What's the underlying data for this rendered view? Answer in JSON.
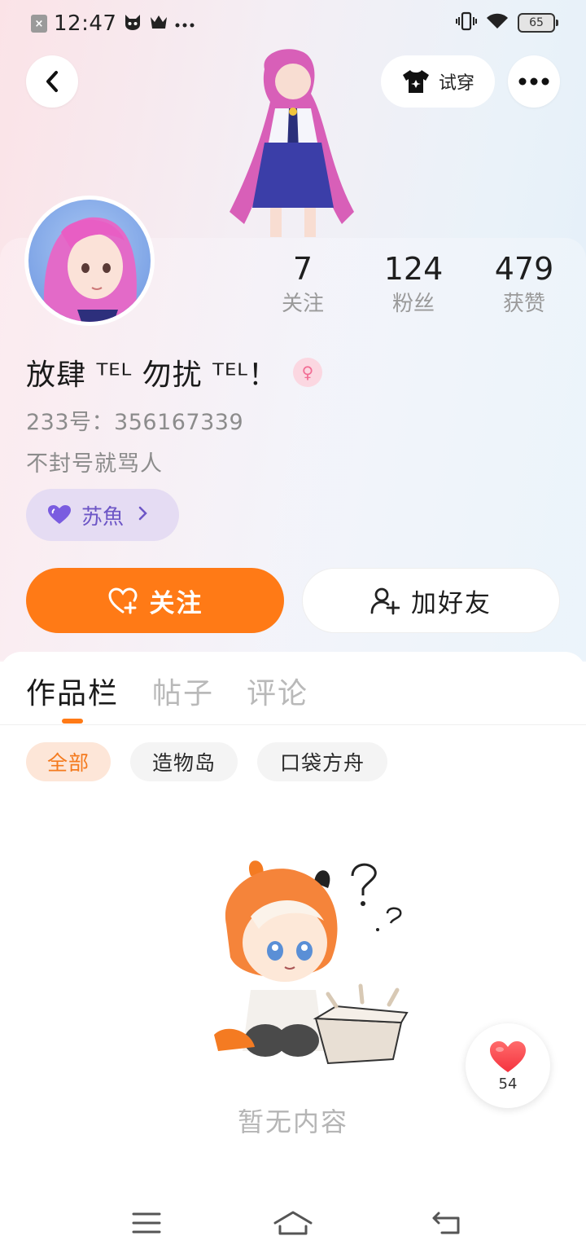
{
  "status_bar": {
    "time": "12:47",
    "battery": "65",
    "left_icons": [
      "sim-off-icon",
      "cat-face-icon",
      "crown-icon",
      "more-dots-icon"
    ],
    "right_icons": [
      "vibrate-icon",
      "wifi-icon",
      "battery-icon"
    ]
  },
  "header": {
    "try_on_label": "试穿"
  },
  "stats": [
    {
      "value": "7",
      "label": "关注"
    },
    {
      "value": "124",
      "label": "粉丝"
    },
    {
      "value": "479",
      "label": "获赞"
    }
  ],
  "profile": {
    "name": "放肆 ᵀᴱᴸ 勿扰 ᵀᴱᴸ！",
    "gender_symbol": "♀",
    "uid_line": "233号：356167339",
    "bio": "不封号就骂人",
    "guild": "苏魚"
  },
  "actions": {
    "follow_label": "关注",
    "add_friend_label": "加好友"
  },
  "tabs": [
    "作品栏",
    "帖子",
    "评论"
  ],
  "filters": [
    "全部",
    "造物岛",
    "口袋方舟"
  ],
  "empty_state": "暂无内容",
  "like_fab": {
    "count": "54"
  },
  "colors": {
    "accent": "#ff7a16",
    "guild_bg": "#e5dcf3",
    "guild_text": "#6d56c6"
  }
}
